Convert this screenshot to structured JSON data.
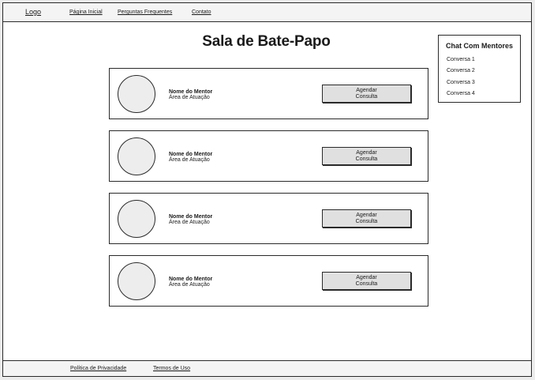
{
  "header": {
    "logo": "Logo",
    "nav": [
      "Página Inicial",
      "Perguntas Frequentes",
      "Contato"
    ]
  },
  "main": {
    "title": "Sala de Bate-Papo",
    "mentors": [
      {
        "name": "Nome do Mentor",
        "area": "Área de Atuação",
        "button_line1": "Agendar",
        "button_line2": "Consulta"
      },
      {
        "name": "Nome do Mentor",
        "area": "Área de Atuação",
        "button_line1": "Agendar",
        "button_line2": "Consulta"
      },
      {
        "name": "Nome do Mentor",
        "area": "Área de Atuação",
        "button_line1": "Agendar",
        "button_line2": "Consulta"
      },
      {
        "name": "Nome do Mentor",
        "area": "Área de Atuação",
        "button_line1": "Agendar",
        "button_line2": "Consulta"
      }
    ]
  },
  "sidebar": {
    "title": "Chat Com Mentores",
    "conversations": [
      "Conversa 1",
      "Conversa 2",
      "Conversa 3",
      "Conversa 4"
    ]
  },
  "footer": {
    "links": [
      "Política de Privacidade",
      "Termos de Uso"
    ]
  },
  "colors": {
    "border": "#2a2a2a",
    "button_bg": "#e0e0e0",
    "avatar_bg": "#ededed",
    "bar_bg": "#f4f4f4"
  }
}
